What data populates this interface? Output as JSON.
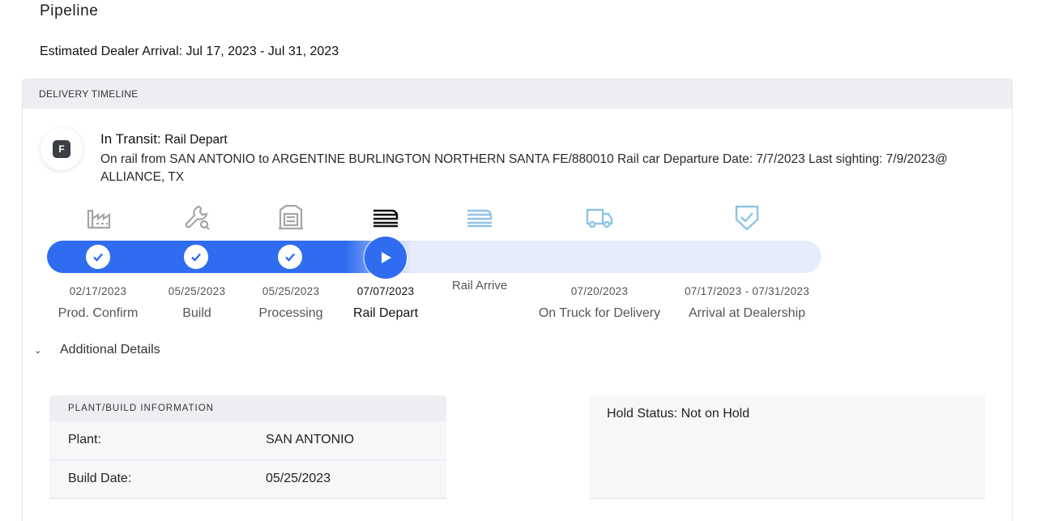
{
  "page": {
    "title": "Pipeline",
    "arrival_label": "Estimated Dealer Arrival:",
    "arrival_range": "Jul 17, 2023 - Jul 31, 2023"
  },
  "timeline": {
    "header": "DELIVERY TIMELINE",
    "badge_letter": "F",
    "status_label": "In Transit:",
    "status_value": "Rail Depart",
    "description": "On rail from SAN ANTONIO to ARGENTINE BURLINGTON NORTHERN SANTA FE/880010 Rail car Departure Date: 7/7/2023 Last sighting: 7/9/2023@ ALLIANCE, TX",
    "progress_fraction": 0.47,
    "steps": [
      {
        "date": "02/17/2023",
        "name": "Prod. Confirm",
        "state": "done",
        "icon": "factory-icon"
      },
      {
        "date": "05/25/2023",
        "name": "Build",
        "state": "done",
        "icon": "wrench-icon"
      },
      {
        "date": "05/25/2023",
        "name": "Processing",
        "state": "done",
        "icon": "processing-icon"
      },
      {
        "date": "07/07/2023",
        "name": "Rail Depart",
        "state": "current",
        "icon": "rail-depart-icon"
      },
      {
        "date": "",
        "name": "Rail Arrive",
        "state": "upcoming",
        "icon": "rail-arrive-icon"
      },
      {
        "date": "07/20/2023",
        "name": "On Truck for Delivery",
        "state": "upcoming",
        "icon": "truck-icon"
      },
      {
        "date": "07/17/2023 - 07/31/2023",
        "name": "Arrival at Dealership",
        "state": "upcoming",
        "icon": "shield-check-icon"
      }
    ],
    "colors": {
      "done": "#2f6cf0",
      "track": "#e6ecfb",
      "inactive_icon": "#a5a5a5",
      "upcoming_icon": "#8fc3e6"
    }
  },
  "details": {
    "toggle_label": "Additional Details",
    "plant": {
      "header": "PLANT/BUILD INFORMATION",
      "rows": [
        {
          "label": "Plant:",
          "value": "SAN ANTONIO"
        },
        {
          "label": "Build Date:",
          "value": "05/25/2023"
        }
      ]
    },
    "hold": {
      "text": "Hold Status: Not on Hold"
    }
  }
}
